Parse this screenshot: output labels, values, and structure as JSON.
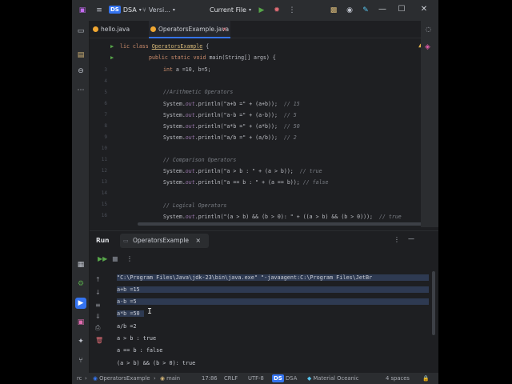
{
  "titlebar": {
    "project_badge": "DS",
    "project_name": "DSA",
    "vcs_label": "Versi...",
    "run_config": "Current File"
  },
  "tabs": [
    {
      "label": "hello.java"
    },
    {
      "label": "OperatorsExample.java"
    }
  ],
  "editor": {
    "line_numbers": [
      "",
      "",
      "3",
      "4",
      "5",
      "6",
      "7",
      "8",
      "9",
      "10",
      "11",
      "12",
      "13",
      "14",
      "15",
      "16"
    ],
    "l1": "lic class ",
    "l1_class": "OperatorsExample",
    "l1_brace": " {",
    "l2_pub": "public static void ",
    "l2_main": "main(String[] args) {",
    "l3_int": "int ",
    "l3_rest": "a =10, b=5;",
    "c_arith": "//Arithmetic Operators",
    "sys": "System.",
    "out": "out",
    "l6a": ".println(\"a+b =\" + (a+b));",
    "l6c": "// 15",
    "l7a": ".println(\"a-b =\" + (a-b));",
    "l7c": "// 5",
    "l8a": ".println(\"a*b =\" + (a*b));",
    "l8c": "// 50",
    "l9a": ".println(\"a/b =\" + (a/b));",
    "l9c": "// 2",
    "c_comp": "// Comparison Operators",
    "l12a": ".println(\"a > b : \" + (a > b));",
    "l12c": "// true",
    "l13a": ".println(\"a == b : \" + (a == b));",
    "l13c": "// false",
    "c_logic": "// Logical Operators",
    "l16a": ".println(\"(a > b) && (b > 0): \" + ((a > b) && (b > 0)));",
    "l16c": "// true"
  },
  "run_panel": {
    "title": "Run",
    "tab_label": "OperatorsExample",
    "console": [
      "\"C:\\Program Files\\Java\\jdk-23\\bin\\java.exe\" \"-javaagent:C:\\Program Files\\JetBr",
      "a+b =15",
      "a-b =5",
      "a*b =50",
      "a/b =2",
      "a > b : true",
      "a == b : false",
      "(a > b) && (b > 0): true"
    ]
  },
  "statusbar": {
    "breadcrumb_root": "rc",
    "breadcrumb_class": "OperatorsExample",
    "breadcrumb_method": "main",
    "position": "17:86",
    "line_sep": "CRLF",
    "encoding": "UTF-8",
    "project_badge": "DS",
    "project": "DSA",
    "theme": "Material Oceanic",
    "indent": "4 spaces"
  },
  "colors": {
    "accent": "#3574f0",
    "run_green": "#57a64a",
    "background": "#1e1f22"
  }
}
